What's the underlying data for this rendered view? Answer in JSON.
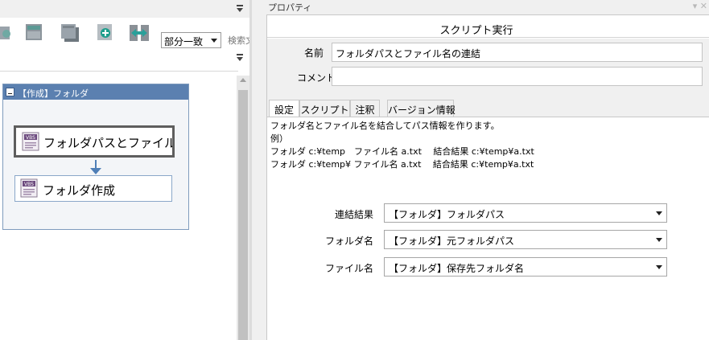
{
  "toolbar": {
    "icons": [
      "import-icon",
      "sheet-icon",
      "sheet-stack-icon",
      "add-icon",
      "swap-icon"
    ],
    "match_mode": "部分一致",
    "search_placeholder": "検索文"
  },
  "flow": {
    "group_title": "【作成】フォルダ",
    "nodes": [
      {
        "label": "フォルダパスとファイル名...",
        "icon": "vbs-script-icon",
        "selected": true
      },
      {
        "label": "フォルダ作成",
        "icon": "vbs-script-icon",
        "selected": false
      }
    ]
  },
  "properties": {
    "panel_title": "プロパティ",
    "header": "スクリプト実行",
    "name_label": "名前",
    "name_value": "フォルダパスとファイル名の連結",
    "comment_label": "コメント",
    "comment_value": "",
    "tabs": [
      "設定",
      "スクリプト",
      "注釈",
      "バージョン情報"
    ],
    "active_tab": "設定",
    "description": [
      "フォルダ名とファイル名を結合してパス情報を作ります。",
      "例）",
      "フォルダ c:¥temp　ファイル名 a.txt　 結合結果 c:¥temp¥a.txt",
      "フォルダ c:¥temp¥  ファイル名 a.txt　 結合結果 c:¥temp¥a.txt"
    ],
    "fields": [
      {
        "label": "連結結果",
        "value": "【フォルダ】フォルダパス"
      },
      {
        "label": "フォルダ名",
        "value": "【フォルダ】元フォルダパス"
      },
      {
        "label": "ファイル名",
        "value": "【フォルダ】保存先フォルダ名"
      }
    ]
  },
  "colors": {
    "group_header": "#5b80b0",
    "connector": "#4f7fb7",
    "selected_border": "#5e5e5e"
  }
}
